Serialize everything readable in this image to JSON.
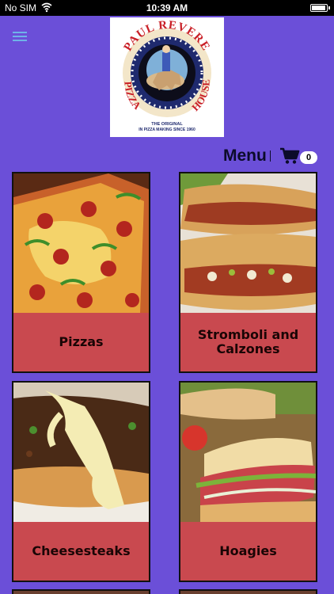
{
  "status_bar": {
    "carrier": "No SIM",
    "time": "10:39 AM"
  },
  "logo": {
    "top_text": "PAUL REVERE",
    "left_text": "PIZZA",
    "right_text": "HOUSE",
    "tagline_line1": "THE ORIGINAL",
    "tagline_line2": "IN PIZZA MAKING SINCE 1960"
  },
  "header": {
    "menu_title": "Menu",
    "cart_count": "0"
  },
  "categories": [
    {
      "label": "Pizzas"
    },
    {
      "label": "Stromboli and Calzones"
    },
    {
      "label": "Cheesesteaks"
    },
    {
      "label": "Hoagies"
    }
  ],
  "colors": {
    "background": "#6b4fd8",
    "tile_label_bg": "#c9494f",
    "hamburger": "#6fb3e8"
  }
}
